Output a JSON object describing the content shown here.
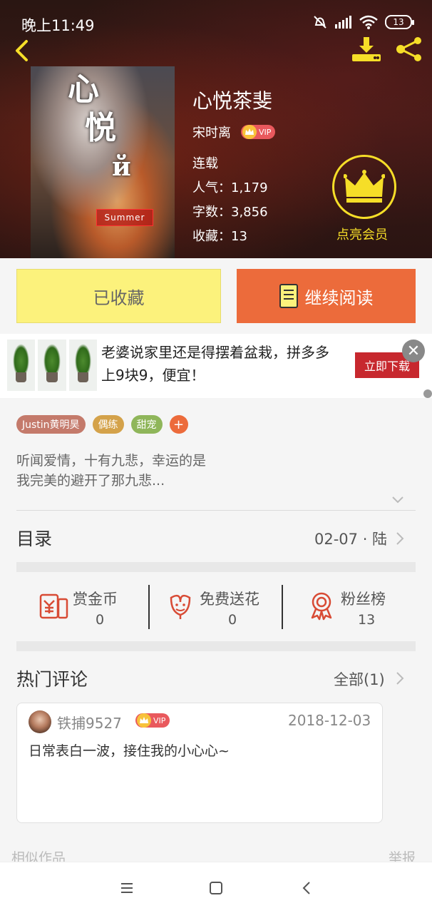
{
  "status_bar": {
    "time": "晚上11:49",
    "battery": "13"
  },
  "book": {
    "title": "心悦茶斐",
    "author": "宋时离",
    "vip_label": "VIP",
    "status": "连载",
    "popularity": "人气：1,179",
    "word_count": "字数：3,856",
    "favorites": "收藏：13"
  },
  "cover": {
    "title_chars": [
      "心",
      "悦",
      "й"
    ],
    "tag": "Summer"
  },
  "member": {
    "label": "点亮会员"
  },
  "actions": {
    "collected": "已收藏",
    "continue_reading": "继续阅读"
  },
  "ad": {
    "text": "老婆说家里还是得摆着盆栽，拼多多上9块9，便宜！",
    "download": "立即下载",
    "close": "✕"
  },
  "tags": [
    {
      "label": "Justin黄明昊",
      "color": "#c47a6b"
    },
    {
      "label": "偶练",
      "color": "#d4a24a"
    },
    {
      "label": "甜宠",
      "color": "#8fb65a"
    }
  ],
  "tag_add": "+",
  "description": [
    "听闻爱情，十有九悲，幸运的是",
    "我完美的避开了那九悲..."
  ],
  "catalog": {
    "label": "目录",
    "latest": "02-07 · 陆"
  },
  "stats": [
    {
      "label": "赏金币",
      "value": "0",
      "icon": "coin-envelope-icon"
    },
    {
      "label": "免费送花",
      "value": "0",
      "icon": "flower-icon"
    },
    {
      "label": "粉丝榜",
      "value": "13",
      "icon": "medal-icon"
    }
  ],
  "comments": {
    "label": "热门评论",
    "all": "全部(1)",
    "items": [
      {
        "user": "铁捕9527",
        "vip": "VIP",
        "date": "2018-12-03",
        "text": "日常表白一波，接住我的小心心~"
      }
    ]
  },
  "footer": {
    "similar": "相似作品",
    "report": "举报"
  },
  "colors": {
    "accent": "#ec6b3b",
    "collected_bg": "#fcf27c",
    "member": "#f6de28",
    "vip": "#e9595d"
  }
}
